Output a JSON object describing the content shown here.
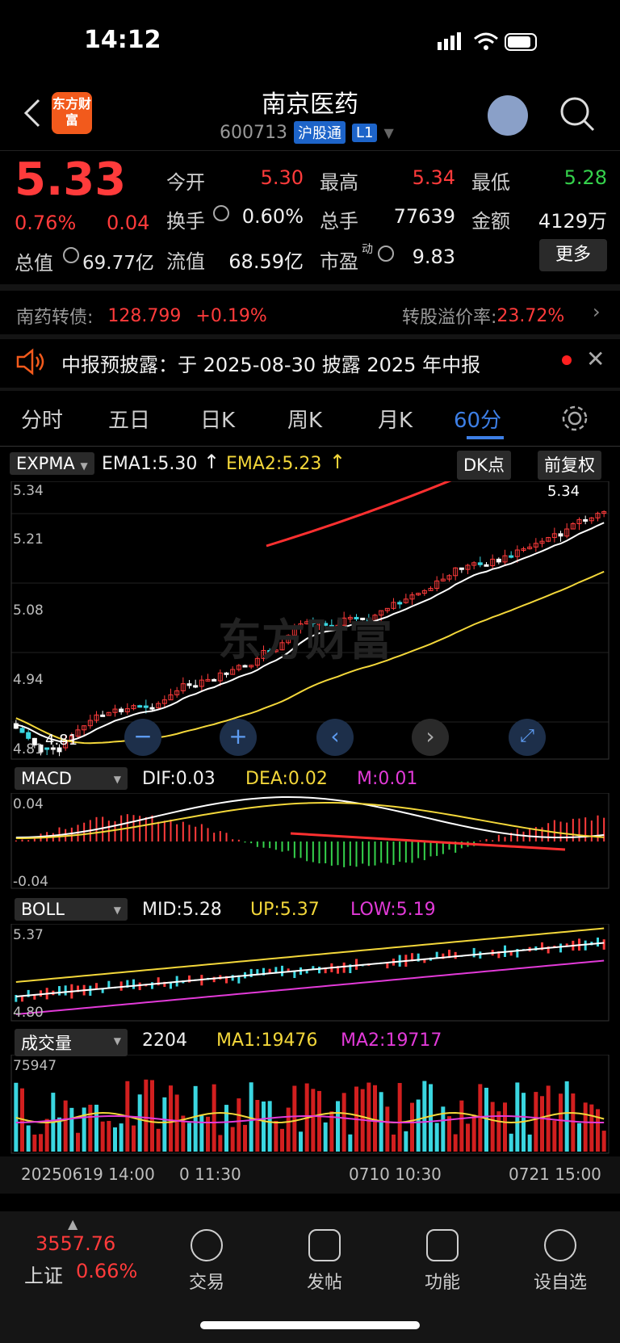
{
  "status": {
    "time": "14:12"
  },
  "header": {
    "logo_text": "东方财富",
    "title": "南京医药",
    "code": "600713",
    "tag1": "沪股通",
    "tag2": "L1"
  },
  "quote": {
    "price": "5.33",
    "change_pct": "0.76%",
    "change": "0.04",
    "open_label": "今开",
    "open": "5.30",
    "high_label": "最高",
    "high": "5.34",
    "low_label": "最低",
    "low": "5.28",
    "turnover_label": "换手",
    "turnover": "0.60%",
    "volume_label": "总手",
    "volume": "77639",
    "amount_label": "金额",
    "amount": "4129万",
    "mcap_label": "总值",
    "mcap": "69.77亿",
    "float_label": "流值",
    "float": "68.59亿",
    "pe_label": "市盈",
    "pe_sup": "动",
    "pe": "9.83",
    "more": "更多"
  },
  "bond": {
    "name": "南药转债:",
    "price": "128.799",
    "change": "+0.19%",
    "premium_label": "转股溢价率:",
    "premium": "23.72%"
  },
  "notice": {
    "text": "中报预披露：于 2025-08-30 披露 2025 年中报"
  },
  "tabs": [
    "分时",
    "五日",
    "日K",
    "周K",
    "月K",
    "60分"
  ],
  "colors": {
    "up": "#ff3b3b",
    "down": "#35d24c",
    "accent": "#3d7fe6",
    "ema1": "#ffffff",
    "ema2": "#f3d73a",
    "magenta": "#e23ad8"
  },
  "expma": {
    "selector": "EXPMA",
    "ema1": "EMA1:5.30",
    "ema2": "EMA2:5.23",
    "dk": "DK点",
    "fq": "前复权",
    "y_top": "5.34",
    "y_2": "5.21",
    "y_3": "5.08",
    "y_4": "4.94",
    "y_bottom": "4.81",
    "high_mark": "5.34",
    "low_mark": "4.81",
    "watermark": "东方财富"
  },
  "macd": {
    "selector": "MACD",
    "dif": "DIF:0.03",
    "dea": "DEA:0.02",
    "m": "M:0.01",
    "y_top": "0.04",
    "y_bottom": "-0.04"
  },
  "boll": {
    "selector": "BOLL",
    "mid": "MID:5.28",
    "up": "UP:5.37",
    "low": "LOW:5.19",
    "y_top": "5.37",
    "y_bottom": "4.80"
  },
  "volume": {
    "selector": "成交量",
    "value": "2204",
    "ma1": "MA1:19476",
    "ma2": "MA2:19717",
    "y_top": "75947"
  },
  "x_axis": {
    "t1": "20250619 14:00",
    "t2": "0 11:30",
    "t3": "0710 10:30",
    "t4": "0721 15:00"
  },
  "nav": {
    "index_value": "3557.76",
    "index_name": "上证",
    "index_change": "0.66%",
    "trade": "交易",
    "post": "发帖",
    "func": "功能",
    "watch": "设自选"
  }
}
